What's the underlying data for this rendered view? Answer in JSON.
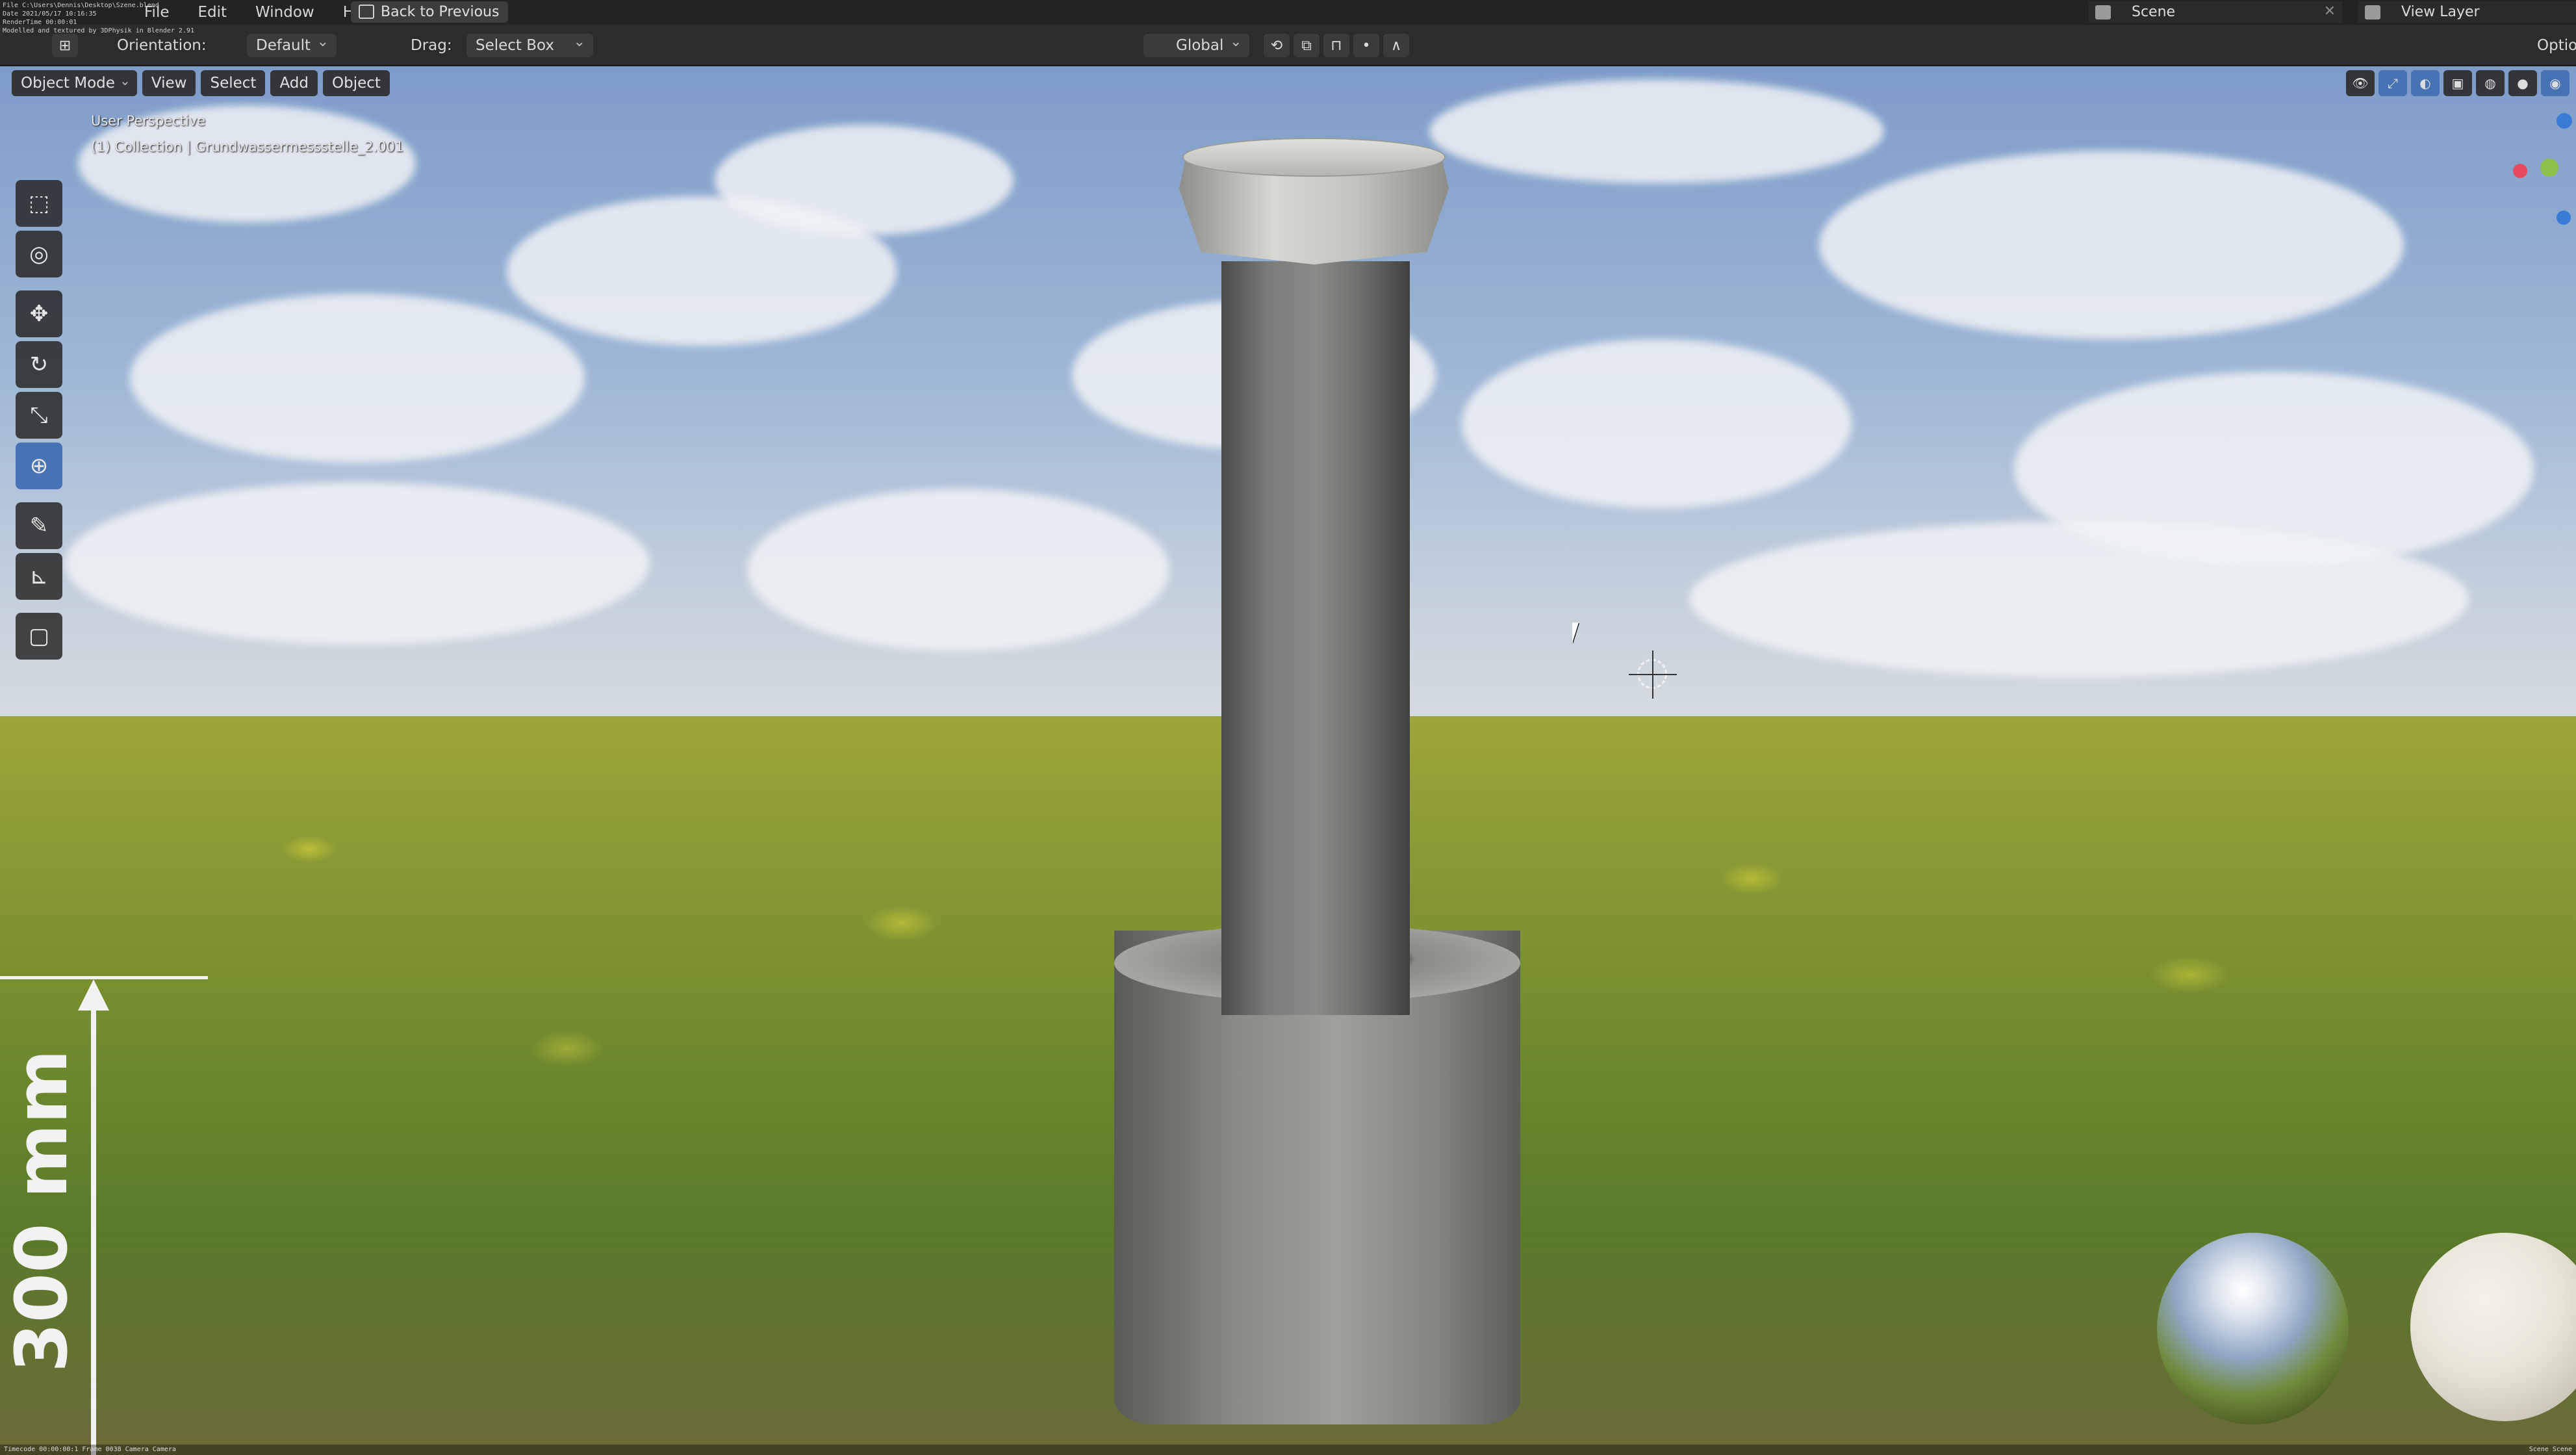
{
  "menubar": {
    "items": [
      "File",
      "Edit",
      "Window",
      "Help"
    ],
    "back_label": "Back to Previous",
    "stamp_lines": [
      "File C:\\Users\\Dennis\\Desktop\\Szene.blend",
      "Date 2021/05/17 10:16:35",
      "RenderTime 00:00:01",
      "Modelled and textured by 3DPhysik in Blender 2.91"
    ]
  },
  "scene": {
    "label": "Scene"
  },
  "view_layer": {
    "label": "View Layer"
  },
  "tool_header": {
    "orientation_label": "Orientation:",
    "orientation_value": "Default",
    "drag_label": "Drag:",
    "drag_value": "Select Box",
    "transform_orientation": "Global",
    "options_label": "Options"
  },
  "viewport_header": {
    "mode": "Object Mode",
    "menus": [
      "View",
      "Select",
      "Add",
      "Object"
    ]
  },
  "viewport": {
    "perspective": "User Perspective",
    "collection_info": "(1) Collection | Grundwassermessstelle_2.001",
    "scale_label": "300 mm"
  },
  "toolbar": {
    "tools": [
      {
        "icon": "select-box-icon",
        "glyph": "⬚",
        "active": false
      },
      {
        "icon": "cursor-icon",
        "glyph": "◎",
        "active": false
      },
      {
        "icon": "move-icon",
        "glyph": "✥",
        "active": false
      },
      {
        "icon": "rotate-icon",
        "glyph": "↻",
        "active": false
      },
      {
        "icon": "scale-icon",
        "glyph": "⤡",
        "active": false
      },
      {
        "icon": "transform-icon",
        "glyph": "⊕",
        "active": true
      },
      {
        "icon": "annotate-icon",
        "glyph": "✎",
        "active": false
      },
      {
        "icon": "measure-icon",
        "glyph": "⊾",
        "active": false
      },
      {
        "icon": "add-cube-icon",
        "glyph": "▢",
        "active": false
      }
    ]
  },
  "bottom_stamp": {
    "left": "Timecode 00:00:00:1 Frame 0038 Camera Camera",
    "right": "Scene Scene"
  },
  "colors": {
    "accent": "#4772b3",
    "gizmo_x": "#e84a5f",
    "gizmo_y": "#8bc34a",
    "gizmo_z": "#3a7bd5"
  }
}
